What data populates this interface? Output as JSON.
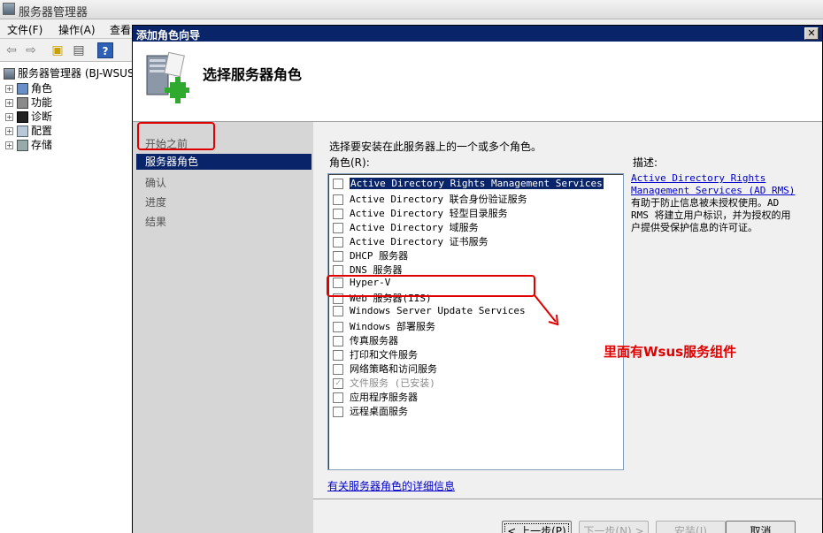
{
  "bg_window": {
    "title": "服务器管理器",
    "menu": [
      "文件(F)",
      "操作(A)",
      "查看"
    ],
    "tree": [
      {
        "label": "服务器管理器 (BJ-WSUS",
        "level": 0
      },
      {
        "label": "角色",
        "level": 1
      },
      {
        "label": "功能",
        "level": 1
      },
      {
        "label": "诊断",
        "level": 1
      },
      {
        "label": "配置",
        "level": 1
      },
      {
        "label": "存储",
        "level": 1
      }
    ]
  },
  "wizard": {
    "title": "添加角色向导",
    "close": "✕",
    "header_title": "选择服务器角色",
    "nav": [
      "开始之前",
      "服务器角色",
      "确认",
      "进度",
      "结果"
    ],
    "instructions": "选择要安装在此服务器上的一个或多个角色。",
    "roles_label": "角色(R):",
    "roles": [
      {
        "label": "Active Directory Rights Management Services",
        "checked": false,
        "selected": true
      },
      {
        "label": "Active Directory 联合身份验证服务",
        "checked": false
      },
      {
        "label": "Active Directory 轻型目录服务",
        "checked": false
      },
      {
        "label": "Active Directory 域服务",
        "checked": false
      },
      {
        "label": "Active Directory 证书服务",
        "checked": false
      },
      {
        "label": "DHCP 服务器",
        "checked": false
      },
      {
        "label": "DNS 服务器",
        "checked": false
      },
      {
        "label": "Hyper-V",
        "checked": false
      },
      {
        "label": "Web 服务器(IIS)",
        "checked": false
      },
      {
        "label": "Windows Server Update Services",
        "checked": false
      },
      {
        "label": "Windows 部署服务",
        "checked": false
      },
      {
        "label": "传真服务器",
        "checked": false
      },
      {
        "label": "打印和文件服务",
        "checked": false
      },
      {
        "label": "网络策略和访问服务",
        "checked": false
      },
      {
        "label": "文件服务  (已安装)",
        "checked": true,
        "disabled": true
      },
      {
        "label": "应用程序服务器",
        "checked": false
      },
      {
        "label": "远程桌面服务",
        "checked": false
      }
    ],
    "desc_label": "描述:",
    "desc_link": "Active Directory Rights Management Services (AD RMS)",
    "desc_text": "有助于防止信息被未授权使用。AD RMS 将建立用户标识，并为授权的用户提供受保护信息的许可证。",
    "more_link": "有关服务器角色的详细信息",
    "buttons": {
      "prev": "< 上一步(P)",
      "next": "下一步(N) >",
      "install": "安装(I)",
      "cancel": "取消"
    }
  },
  "annotation": "里面有Wsus服务组件",
  "colors": {
    "titlebar": "#0a246a",
    "highlight": "#0a246a",
    "annotation": "#e00000",
    "link": "#0000cc"
  }
}
